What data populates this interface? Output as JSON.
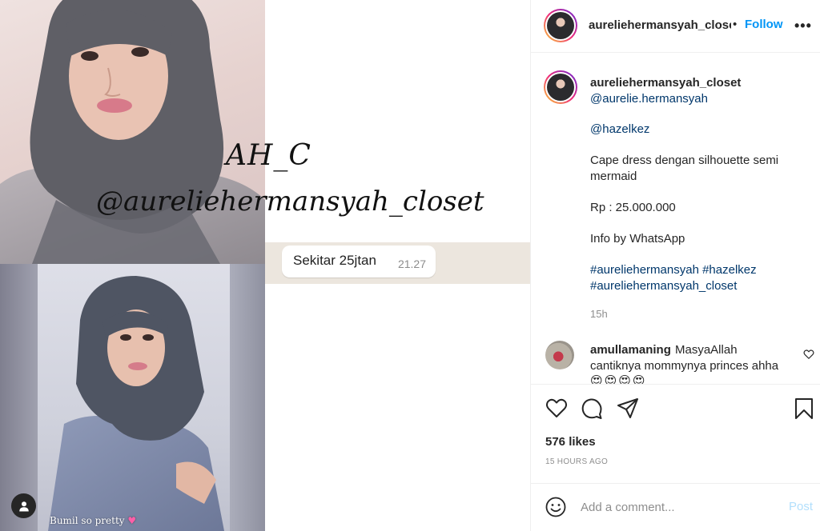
{
  "media": {
    "watermark_line1": "AH_C",
    "watermark_line2": "@aureliehermansyah_closet",
    "chat_message": "Sekitar 25jtan",
    "chat_time": "21.27",
    "photo_caption": "Bumil so pretty",
    "tag_icon": "user-tag-icon"
  },
  "header": {
    "username": "aureliehermansyah_closet",
    "separator": "•",
    "follow_label": "Follow",
    "more_icon": "more-options-icon"
  },
  "caption": {
    "username": "aureliehermansyah_closet",
    "mention1": "@aurelie.hermansyah",
    "mention2": "@hazelkez",
    "desc_line1": "Cape dress dengan silhouette semi",
    "desc_line2": "mermaid",
    "price": "Rp : 25.000.000",
    "info": "Info by WhatsApp",
    "hashtag1": "#aureliehermansyah",
    "hashtag2": "#hazelkez",
    "hashtag3": "#aureliehermansyah_closet",
    "time": "15h"
  },
  "comment": {
    "username": "amullamaning",
    "text_line1": "MasyaAllah",
    "text_line2": "cantiknya mommynya princes ahha",
    "emoji": "😍😍😍😍"
  },
  "actions": {
    "likes": "576 likes",
    "timestamp": "15 HOURS AGO",
    "icons": [
      "heart-icon",
      "comment-icon",
      "share-icon",
      "bookmark-icon"
    ]
  },
  "add_comment": {
    "placeholder": "Add a comment...",
    "post_label": "Post"
  },
  "colors": {
    "accent": "#0095f6",
    "link": "#00376b",
    "muted": "#8e8e8e",
    "post_disabled": "#b2dffc"
  }
}
